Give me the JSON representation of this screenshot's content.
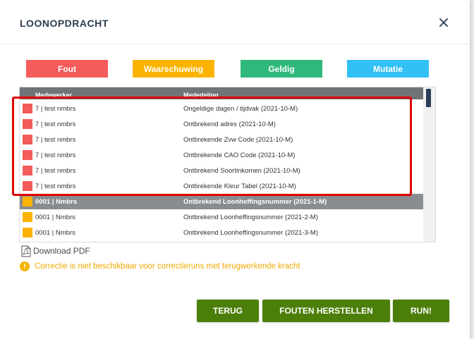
{
  "dialog": {
    "title": "LOONOPDRACHT"
  },
  "legend": [
    {
      "label": "Fout",
      "color": "#f45b5b"
    },
    {
      "label": "Waarschuwing",
      "color": "#fbb300"
    },
    {
      "label": "Geldig",
      "color": "#2fb87a"
    },
    {
      "label": "Mutatie",
      "color": "#32c0f5"
    }
  ],
  "table": {
    "headers": {
      "employee": "Medewerker",
      "message": "Mededeling"
    },
    "rows": [
      {
        "type": "Fout",
        "employee": "7 | test nmbrs",
        "message": "Ongeldige dagen / tijdvak (2021-10-M)"
      },
      {
        "type": "Fout",
        "employee": "7 | test nmbrs",
        "message": "Ontbrekend adres (2021-10-M)"
      },
      {
        "type": "Fout",
        "employee": "7 | test nmbrs",
        "message": "Ontbrekende Zvw Code (2021-10-M)"
      },
      {
        "type": "Fout",
        "employee": "7 | test nmbrs",
        "message": "Ontbrekende CAO Code (2021-10-M)"
      },
      {
        "type": "Fout",
        "employee": "7 | test nmbrs",
        "message": "Ontbrekend Soortinkomen (2021-10-M)"
      },
      {
        "type": "Fout",
        "employee": "7 | test nmbrs",
        "message": "Ontbrekende Kleur Tabel (2021-10-M)"
      },
      {
        "type": "Waarschuwing",
        "group": true,
        "employee": "0001 | Nmbrs",
        "message": "Ontbrekend Loonheffingsnummer (2021-1-M)"
      },
      {
        "type": "Waarschuwing",
        "employee": "0001 | Nmbrs",
        "message": "Ontbrekend Loonheffingsnummer (2021-2-M)"
      },
      {
        "type": "Waarschuwing",
        "employee": "0001 | Nmbrs",
        "message": "Ontbrekend Loonheffingsnummer (2021-3-M)"
      }
    ]
  },
  "download_pdf": "Download PDF",
  "warning_text": "Correctie is niet beschikbaar voor correctieruns met terugwerkende kracht",
  "buttons": {
    "back": "TERUG",
    "fix_errors": "FOUTEN HERSTELLEN",
    "run": "RUN!"
  }
}
